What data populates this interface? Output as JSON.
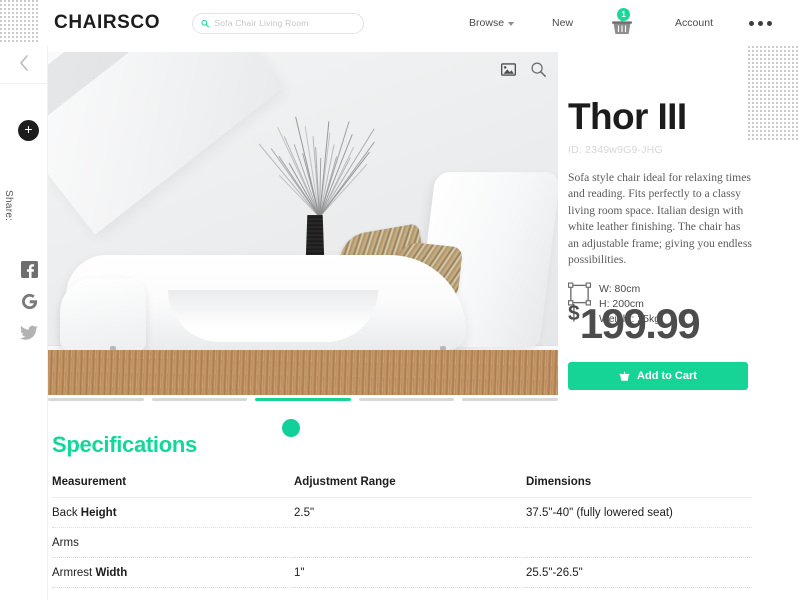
{
  "header": {
    "brand": "CHAIRSCO",
    "search": {
      "placeholder": "Sofa Chair Living Room",
      "value": "",
      "icon": "search-icon"
    },
    "nav": [
      {
        "label": "Browse",
        "has_chevron": true
      },
      {
        "label": "New",
        "has_chevron": false
      },
      {
        "label": "Account",
        "has_chevron": false
      }
    ],
    "cart": {
      "icon": "shopping-basket-icon",
      "badge_count": "1"
    },
    "more": {
      "icon": "more-horizontal-icon"
    }
  },
  "left_rail": {
    "back": {
      "icon": "chevron-left-icon"
    },
    "add": {
      "icon": "plus-circle-icon",
      "glyph": "+"
    },
    "share_label": "Share:",
    "socials": [
      {
        "name": "facebook",
        "glyph": "f"
      },
      {
        "name": "google",
        "glyph": "G"
      },
      {
        "name": "twitter",
        "glyph": "t"
      }
    ]
  },
  "gallery": {
    "tools": [
      {
        "name": "image-gallery-icon"
      },
      {
        "name": "magnifier-zoom-icon"
      }
    ],
    "slides_total": 5,
    "active_slide": 3
  },
  "product": {
    "title": "Thor III",
    "id": "ID: 2349w9G9-JHG",
    "description": "Sofa style chair ideal for relaxing times and reading. Fits perfectly to a classy living room space. Italian design with white leather finishing. The chair has an adjustable frame; giving you endless possibilities.",
    "dimensions": {
      "icon": "measure-frame-icon",
      "width": "W: 80cm",
      "height": "H: 200cm",
      "weight": "Weight: 25kg"
    },
    "price": {
      "currency": "$",
      "amount": "199.99"
    },
    "cta": {
      "label": "Add to Cart",
      "icon": "basket-icon"
    }
  },
  "specifications": {
    "title": "Specifications",
    "columns": [
      "Measurement",
      "Adjustment Range",
      "Dimensions"
    ],
    "rows": [
      {
        "measurement_prefix": "Back ",
        "measurement_bold": "Height",
        "range": "2.5\"",
        "dimensions": "37.5\"-40\" (fully lowered seat)"
      },
      {
        "measurement_prefix": "Arms",
        "measurement_bold": "",
        "range": "",
        "dimensions": ""
      },
      {
        "measurement_prefix": "Armrest ",
        "measurement_bold": "Width",
        "range": "1\"",
        "dimensions": "25.5\"-26.5\""
      }
    ]
  },
  "colors": {
    "accent_green": "#15d496",
    "title_dark": "#1c1c1c",
    "muted_gray": "#9b9b9b"
  }
}
